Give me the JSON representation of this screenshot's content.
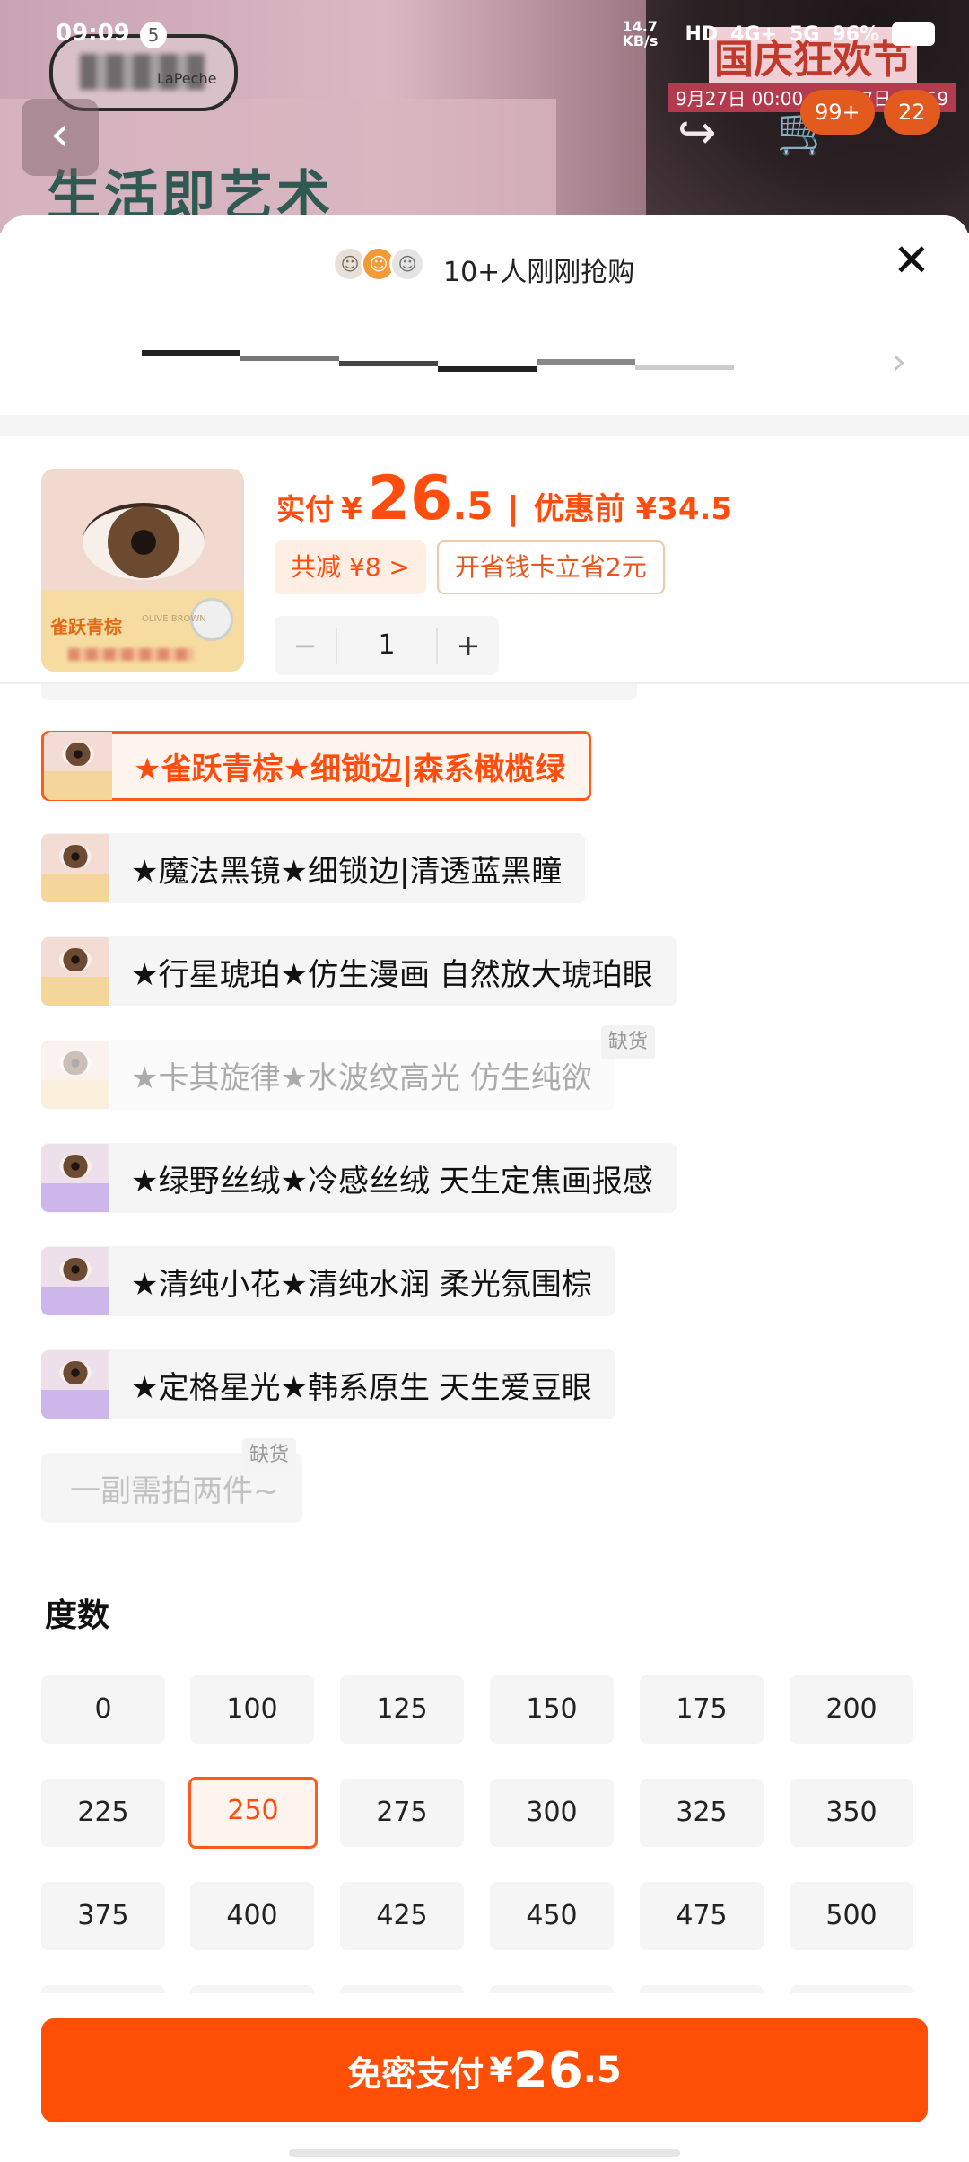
{
  "status_bar": {
    "time": "09:09",
    "notification_count": "5",
    "net_speed": "14.7 KB/s",
    "signal_labels": [
      "HD",
      "4G+",
      "5G"
    ],
    "battery": "96%"
  },
  "background_page": {
    "brand_sub": "LaPeche",
    "slogan": "生活即艺术",
    "event_title": "国庆狂欢节",
    "event_date": "9月27日 00:00 - 10月7日 23:59",
    "back_icon": "chevron-left-icon",
    "share_icon": "share-icon",
    "cart_icon": "cart-icon",
    "cart_badge": "99+",
    "other_badge": "22"
  },
  "sheet": {
    "buyers_text": "10+人刚刚抢购",
    "close_icon": "close-icon"
  },
  "product": {
    "thumb_tag": "雀跃青棕",
    "thumb_tag_en": "OLIVE BROWN",
    "paid_label": "实付",
    "currency": "¥",
    "price_int": "26",
    "price_dec": ".5",
    "separator": "|",
    "coupon_price": "优惠前 ¥34.5",
    "save_chip": "共减 ¥8 >",
    "card_chip": "开省钱卡立省2元",
    "quantity": "1",
    "minus": "−",
    "plus": "+"
  },
  "variants": [
    {
      "label": "★雀跃青棕★细锁边|森系橄榄绿",
      "selected": true,
      "disabled": false,
      "out_of_stock": false
    },
    {
      "label": "★魔法黑镜★细锁边|清透蓝黑瞳",
      "selected": false,
      "disabled": false,
      "out_of_stock": false
    },
    {
      "label": "★行星琥珀★仿生漫画 自然放大琥珀眼",
      "selected": false,
      "disabled": false,
      "out_of_stock": false
    },
    {
      "label": "★卡其旋律★水波纹高光 仿生纯欲",
      "selected": false,
      "disabled": true,
      "out_of_stock": true
    },
    {
      "label": "★绿野丝绒★冷感丝绒 天生定焦画报感",
      "selected": false,
      "disabled": false,
      "out_of_stock": false
    },
    {
      "label": "★清纯小花★清纯水润 柔光氛围棕",
      "selected": false,
      "disabled": false,
      "out_of_stock": false
    },
    {
      "label": "★定格星光★韩系原生 天生爱豆眼",
      "selected": false,
      "disabled": false,
      "out_of_stock": false
    },
    {
      "label": "一副需拍两件~",
      "selected": false,
      "disabled": true,
      "out_of_stock": true
    }
  ],
  "out_of_stock_label": "缺货",
  "power": {
    "title": "度数",
    "options": [
      "0",
      "100",
      "125",
      "150",
      "175",
      "200",
      "225",
      "250",
      "275",
      "300",
      "325",
      "350",
      "375",
      "400",
      "425",
      "450",
      "475",
      "500"
    ],
    "selected": "250"
  },
  "pay_button": {
    "label": "免密支付",
    "currency": "¥",
    "price_int": "26",
    "price_dec": ".5"
  },
  "colors": {
    "accent": "#ff4f06",
    "accent_text": "#ff4d0d",
    "chip_bg": "#ffeee4",
    "option_bg": "#f5f5f5"
  }
}
